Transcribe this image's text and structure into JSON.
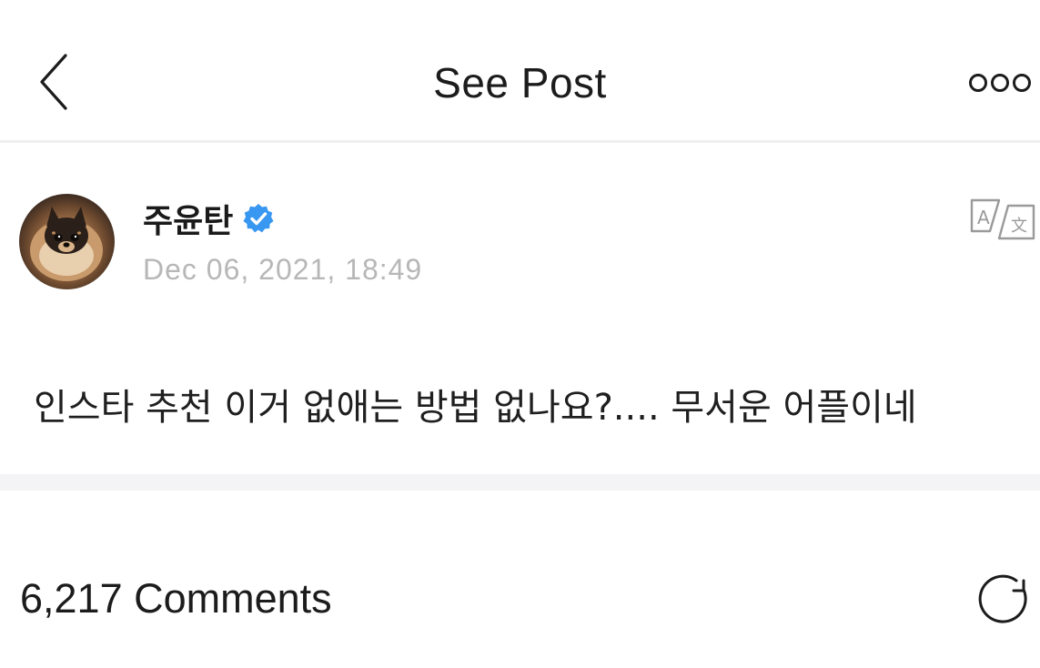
{
  "header": {
    "title": "See Post",
    "back_icon": "chevron-left-icon",
    "more_icon": "more-options-icon"
  },
  "post": {
    "author": "주윤탄",
    "verified": true,
    "verified_color": "#3897f0",
    "timestamp": "Dec 06, 2021, 18:49",
    "text": "인스타 추천 이거 없애는 방법 없나요?.... 무서운 어플이네",
    "translate_icon": "translate-icon"
  },
  "comments": {
    "count_label": "6,217 Comments",
    "refresh_icon": "refresh-icon"
  }
}
